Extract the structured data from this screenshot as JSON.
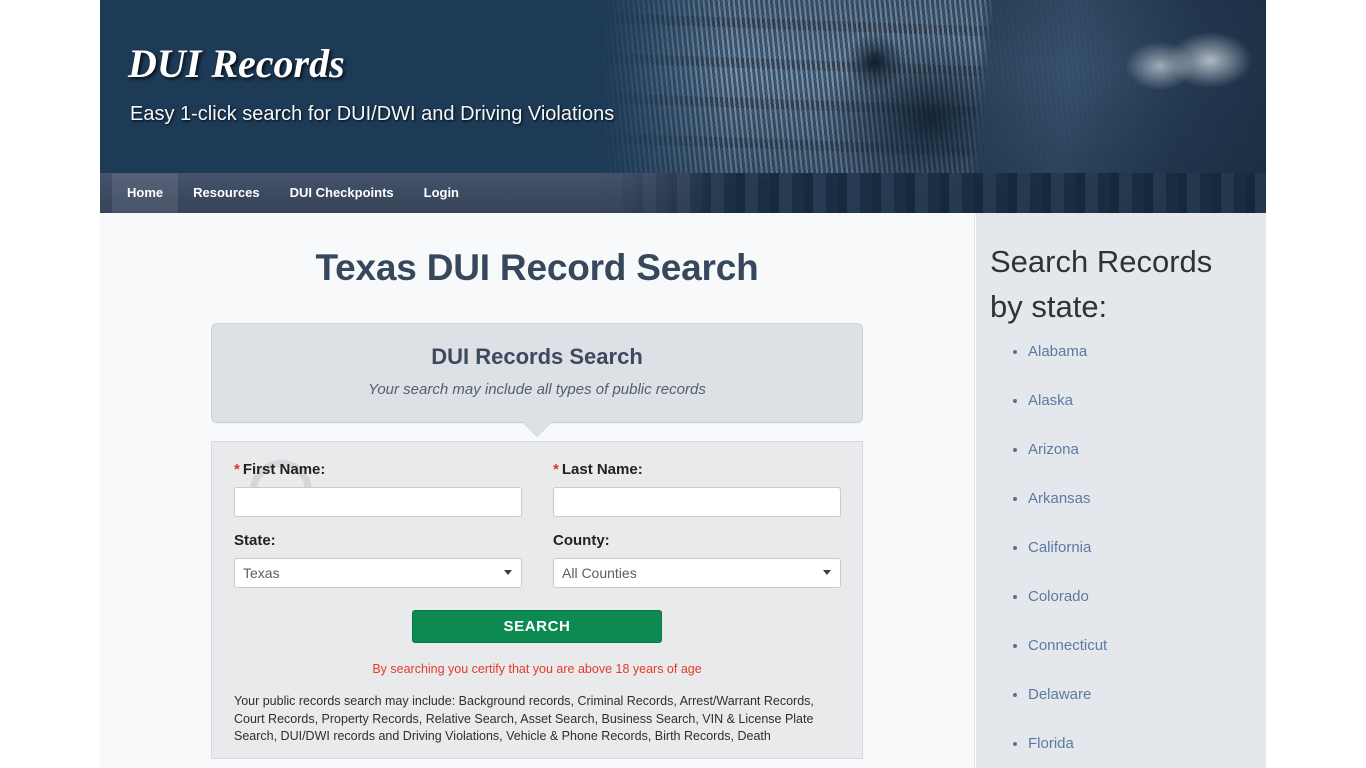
{
  "header": {
    "site_title": "DUI Records",
    "tagline": "Easy 1-click search for DUI/DWI and Driving Violations",
    "background_color": "#1d3a56"
  },
  "nav": {
    "items": [
      {
        "label": "Home",
        "active": true
      },
      {
        "label": "Resources",
        "active": false
      },
      {
        "label": "DUI Checkpoints",
        "active": false
      },
      {
        "label": "Login",
        "active": false
      }
    ],
    "background_color": "#3c4a61"
  },
  "main": {
    "page_title": "Texas DUI Record Search",
    "callout": {
      "title": "DUI Records Search",
      "subtitle": "Your search may include all types of public records"
    },
    "form": {
      "first_name": {
        "label": "First Name:",
        "required_marker": "*",
        "value": "",
        "placeholder": ""
      },
      "last_name": {
        "label": "Last Name:",
        "required_marker": "*",
        "value": "",
        "placeholder": ""
      },
      "state": {
        "label": "State:",
        "selected": "Texas",
        "options": [
          "Texas"
        ]
      },
      "county": {
        "label": "County:",
        "selected": "All Counties",
        "options": [
          "All Counties"
        ]
      },
      "submit_label": "SEARCH",
      "submit_color": "#0d8a52",
      "age_notice": "By searching you certify that you are above 18 years of age",
      "age_notice_color": "#e8392b",
      "disclaimer": "Your public records search may include: Background records, Criminal Records, Arrest/Warrant Records, Court Records, Property Records, Relative Search, Asset Search, Business Search, VIN & License Plate Search, DUI/DWI records and Driving Violations, Vehicle & Phone Records, Birth Records, Death"
    }
  },
  "sidebar": {
    "title": "Search Records by state:",
    "link_color": "#5b7ba3",
    "states": [
      "Alabama",
      "Alaska",
      "Arizona",
      "Arkansas",
      "California",
      "Colorado",
      "Connecticut",
      "Delaware",
      "Florida"
    ]
  }
}
